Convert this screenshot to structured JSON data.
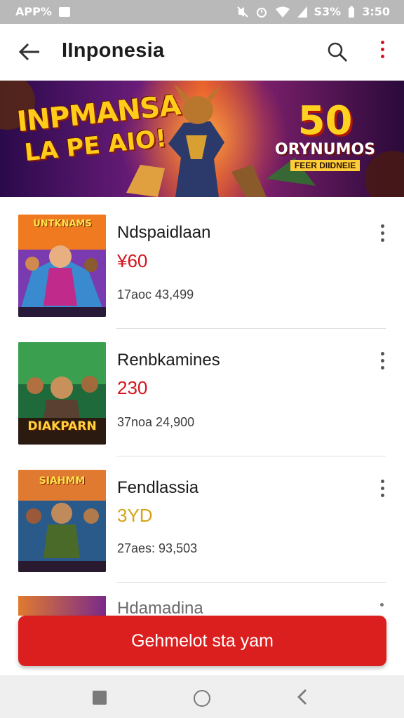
{
  "status_bar": {
    "left_text": "APP%",
    "right_text": "S3%",
    "time": "3:50",
    "icons": [
      "chat-icon",
      "mute-icon",
      "alarm-icon",
      "wifi-icon",
      "signal-icon",
      "battery-icon"
    ]
  },
  "app_bar": {
    "title": "IInponesia",
    "back_icon": "arrow-left-icon",
    "search_icon": "search-icon",
    "more_icon": "more-vertical-icon"
  },
  "banner": {
    "left_line1": "INPMANSA",
    "left_line2": "LA PE AIO!",
    "right_big": "50",
    "right_sub": "ORYNUMOS",
    "right_small": "FEER DIIDNEIE"
  },
  "items": [
    {
      "title": "Ndspaidlaan",
      "price": "¥60",
      "price_color": "#d4141c",
      "meta": "17aoc 43,499",
      "thumb_label": "UNTKNAMS"
    },
    {
      "title": "Renbkamines",
      "price": "230",
      "price_color": "#d4141c",
      "meta": "37noa 24,900",
      "thumb_label": "DIAKPARN"
    },
    {
      "title": "Fendlassia",
      "price": "3YD",
      "price_color": "#d6a312",
      "meta": "27aes: 93,503",
      "thumb_label": "SIAHMM"
    },
    {
      "title": "Hdamadina",
      "price": "",
      "price_color": "#d4141c",
      "meta": "",
      "thumb_label": ""
    }
  ],
  "cta": {
    "label": "Gehmelot sta yam",
    "color": "#db1f1f"
  },
  "nav_bar": {
    "icons": [
      "recents-square-icon",
      "home-circle-icon",
      "back-triangle-icon"
    ]
  }
}
